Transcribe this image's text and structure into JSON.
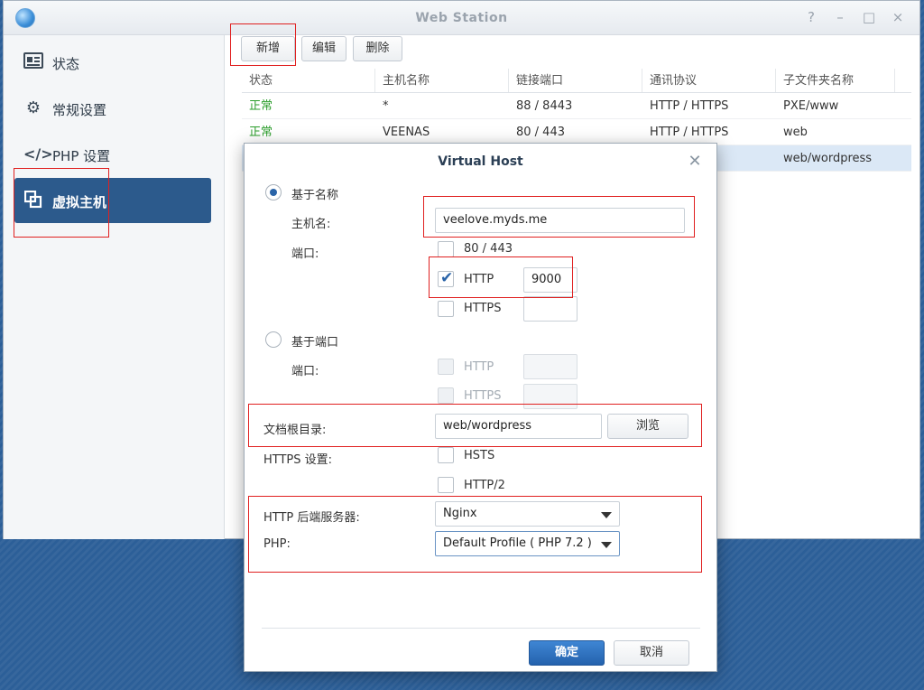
{
  "window": {
    "title": "Web Station",
    "controls": [
      "?",
      "–",
      "□",
      "×"
    ]
  },
  "sidebar": {
    "items": [
      {
        "label": "状态",
        "icon": "status-icon"
      },
      {
        "label": "常规设置",
        "icon": "gear-icon"
      },
      {
        "label": "PHP 设置",
        "icon": "code-icon"
      },
      {
        "label": "虚拟主机",
        "icon": "virtual-host-icon"
      }
    ]
  },
  "toolbar": {
    "add": "新增",
    "edit": "编辑",
    "delete": "删除"
  },
  "table": {
    "columns": [
      "状态",
      "主机名称",
      "链接端口",
      "通讯协议",
      "子文件夹名称"
    ],
    "rows": [
      {
        "status": "正常",
        "host": "*",
        "port": "88 / 8443",
        "protocol": "HTTP / HTTPS",
        "folder": "PXE/www"
      },
      {
        "status": "正常",
        "host": "VEENAS",
        "port": "80 / 443",
        "protocol": "HTTP / HTTPS",
        "folder": "web"
      },
      {
        "status": "",
        "host": "",
        "port": "",
        "protocol": "",
        "folder": "web/wordpress"
      }
    ]
  },
  "dialog": {
    "title": "Virtual Host",
    "name_based": "基于名称",
    "hostname_label": "主机名:",
    "hostname_value": "veelove.myds.me",
    "port_label": "端口:",
    "port_8043": "80 / 443",
    "http": "HTTP",
    "http_port": "9000",
    "https": "HTTPS",
    "port_based": "基于端口",
    "port_label2": "端口:",
    "http2": "HTTP",
    "https2": "HTTPS",
    "docroot_label": "文档根目录:",
    "docroot_value": "web/wordpress",
    "browse": "浏览",
    "https_settings_label": "HTTPS 设置:",
    "hsts": "HSTS",
    "http2_label": "HTTP/2",
    "backend_label": "HTTP 后端服务器:",
    "backend_value": "Nginx",
    "php_label": "PHP:",
    "php_value": "Default Profile ( PHP 7.2 )",
    "ok": "确定",
    "cancel": "取消"
  }
}
